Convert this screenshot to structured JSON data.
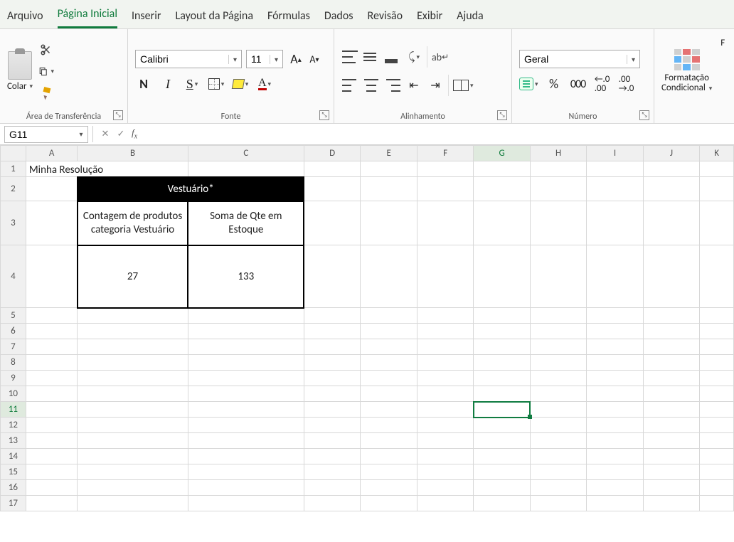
{
  "menu": {
    "items": [
      "Arquivo",
      "Página Inicial",
      "Inserir",
      "Layout da Página",
      "Fórmulas",
      "Dados",
      "Revisão",
      "Exibir",
      "Ajuda"
    ],
    "active_index": 1
  },
  "ribbon": {
    "clipboard": {
      "paste_label": "Colar",
      "group_label": "Área de Transferência"
    },
    "font": {
      "name": "Calibri",
      "size": "11",
      "group_label": "Fonte",
      "bold": "N",
      "italic": "I",
      "underline": "S",
      "fontcolor_letter": "A",
      "increase": "A",
      "decrease": "A"
    },
    "alignment": {
      "group_label": "Alinhamento",
      "wrap": "ab"
    },
    "number": {
      "format": "Geral",
      "group_label": "Número",
      "percent": "%",
      "thousands": "000",
      "dec_more": "←.0\n.00",
      "dec_less": ".00\n→.0"
    },
    "styles": {
      "conditional_label_l1": "Formatação",
      "conditional_label_l2": "Condicional",
      "format_table_initial": "F"
    }
  },
  "namebox": {
    "value": "G11"
  },
  "formula_bar": {
    "value": ""
  },
  "sheet": {
    "columns": [
      "A",
      "B",
      "C",
      "D",
      "E",
      "F",
      "G",
      "H",
      "I",
      "J",
      "K"
    ],
    "row_count": 17,
    "selected": {
      "col": "G",
      "row": 11
    },
    "a1": "Minha Resolução",
    "table": {
      "title": "Vestuário*",
      "headers": [
        "Contagem de produtos categoria Vestuário",
        "Soma de Qte em Estoque"
      ],
      "values": [
        "27",
        "133"
      ]
    }
  },
  "chart_data": {
    "type": "table",
    "title": "Vestuário*",
    "categories": [
      "Contagem de produtos categoria Vestuário",
      "Soma de Qte em Estoque"
    ],
    "values": [
      27,
      133
    ]
  }
}
